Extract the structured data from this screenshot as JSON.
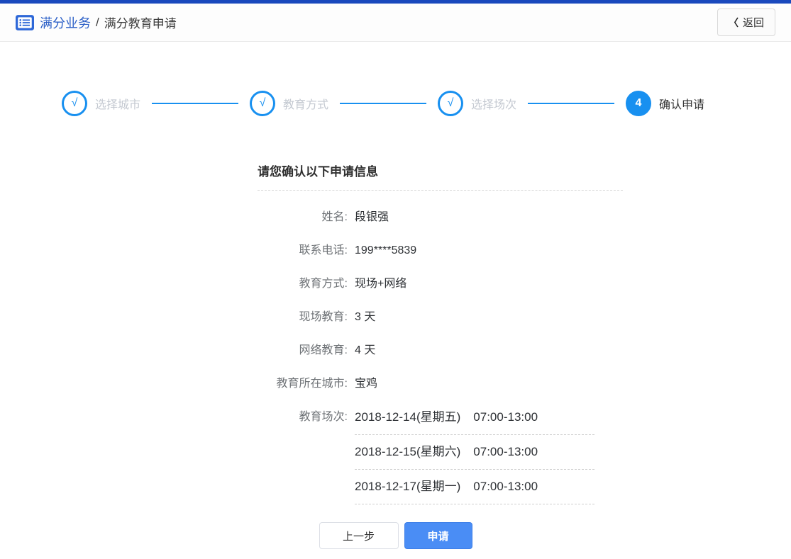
{
  "header": {
    "brand": "满分业务",
    "separator": "/",
    "breadcrumb_current": "满分教育申请",
    "back_label": "返回",
    "back_icon_glyph": "〈"
  },
  "stepper": {
    "steps": [
      {
        "label": "选择城市",
        "mark": "√",
        "status": "done"
      },
      {
        "label": "教育方式",
        "mark": "√",
        "status": "done"
      },
      {
        "label": "选择场次",
        "mark": "√",
        "status": "done"
      },
      {
        "label": "确认申请",
        "mark": "4",
        "status": "current"
      }
    ]
  },
  "form": {
    "title": "请您确认以下申请信息",
    "fields": [
      {
        "label": "姓名:",
        "value": "段银强"
      },
      {
        "label": "联系电话:",
        "value": "199****5839"
      },
      {
        "label": "教育方式:",
        "value": "现场+网络"
      },
      {
        "label": "现场教育:",
        "value": "3 天"
      },
      {
        "label": "网络教育:",
        "value": "4 天"
      },
      {
        "label": "教育所在城市:",
        "value": "宝鸡"
      }
    ],
    "sessions_label": "教育场次:",
    "sessions": [
      {
        "date": "2018-12-14(星期五)",
        "time": "07:00-13:00"
      },
      {
        "date": "2018-12-15(星期六)",
        "time": "07:00-13:00"
      },
      {
        "date": "2018-12-17(星期一)",
        "time": "07:00-13:00"
      }
    ],
    "prev_button": "上一步",
    "apply_button": "申请"
  },
  "colors": {
    "topbar": "#1a49bd",
    "brand_blue": "#2b5fc7",
    "stepper_blue": "#1890f0",
    "step_label_done": "#c4c9d1",
    "apply_button_blue": "#4a8df5"
  }
}
